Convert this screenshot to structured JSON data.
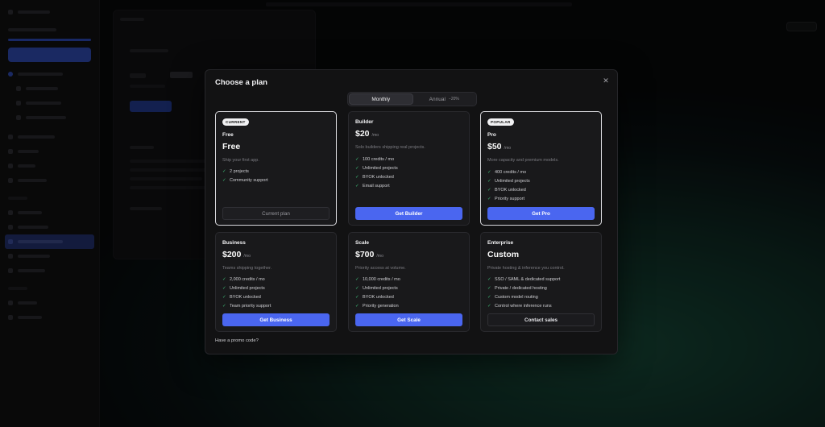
{
  "modal": {
    "title": "Choose a plan",
    "close_icon": "close-icon",
    "promo_link": "Have a promo code?"
  },
  "billing": {
    "options": [
      {
        "label": "Monthly",
        "badge": "",
        "selected": true
      },
      {
        "label": "Annual",
        "badge": "−20%",
        "selected": false
      }
    ]
  },
  "plans": [
    {
      "id": "free",
      "tag": "CURRENT",
      "name": "Free",
      "price": "Free",
      "unit": "",
      "description": "Ship your first app.",
      "features": [
        "2 projects",
        "Community support"
      ],
      "cta": "Current plan"
    },
    {
      "id": "builder",
      "tag": "",
      "name": "Builder",
      "price": "$20",
      "unit": "/mo",
      "description": "Solo builders shipping real projects.",
      "features": [
        "100 credits / mo",
        "Unlimited projects",
        "BYOK unlocked",
        "Email support"
      ],
      "cta": "Get Builder"
    },
    {
      "id": "pro",
      "tag": "POPULAR",
      "name": "Pro",
      "price": "$50",
      "unit": "/mo",
      "description": "More capacity and premium models.",
      "features": [
        "400 credits / mo",
        "Unlimited projects",
        "BYOK unlocked",
        "Priority support"
      ],
      "cta": "Get Pro"
    },
    {
      "id": "business",
      "tag": "",
      "name": "Business",
      "price": "$200",
      "unit": "/mo",
      "description": "Teams shipping together.",
      "features": [
        "2,000 credits / mo",
        "Unlimited projects",
        "BYOK unlocked",
        "Team priority support"
      ],
      "cta": "Get Business"
    },
    {
      "id": "scale",
      "tag": "",
      "name": "Scale",
      "price": "$700",
      "unit": "/mo",
      "description": "Priority access at volume.",
      "features": [
        "10,000 credits / mo",
        "Unlimited projects",
        "BYOK unlocked",
        "Priority generation"
      ],
      "cta": "Get Scale"
    },
    {
      "id": "enterprise",
      "tag": "",
      "name": "Enterprise",
      "price": "Custom",
      "unit": "",
      "description": "Private hosting & inference you control.",
      "features": [
        "SSO / SAML & dedicated support",
        "Private / dedicated hosting",
        "Custom model routing",
        "Control where inference runs"
      ],
      "cta": "Contact sales"
    }
  ],
  "colors": {
    "accent": "#4a66f0",
    "check": "#3fbf7a",
    "modal_bg": "#121213",
    "card_bg": "#19191b"
  }
}
